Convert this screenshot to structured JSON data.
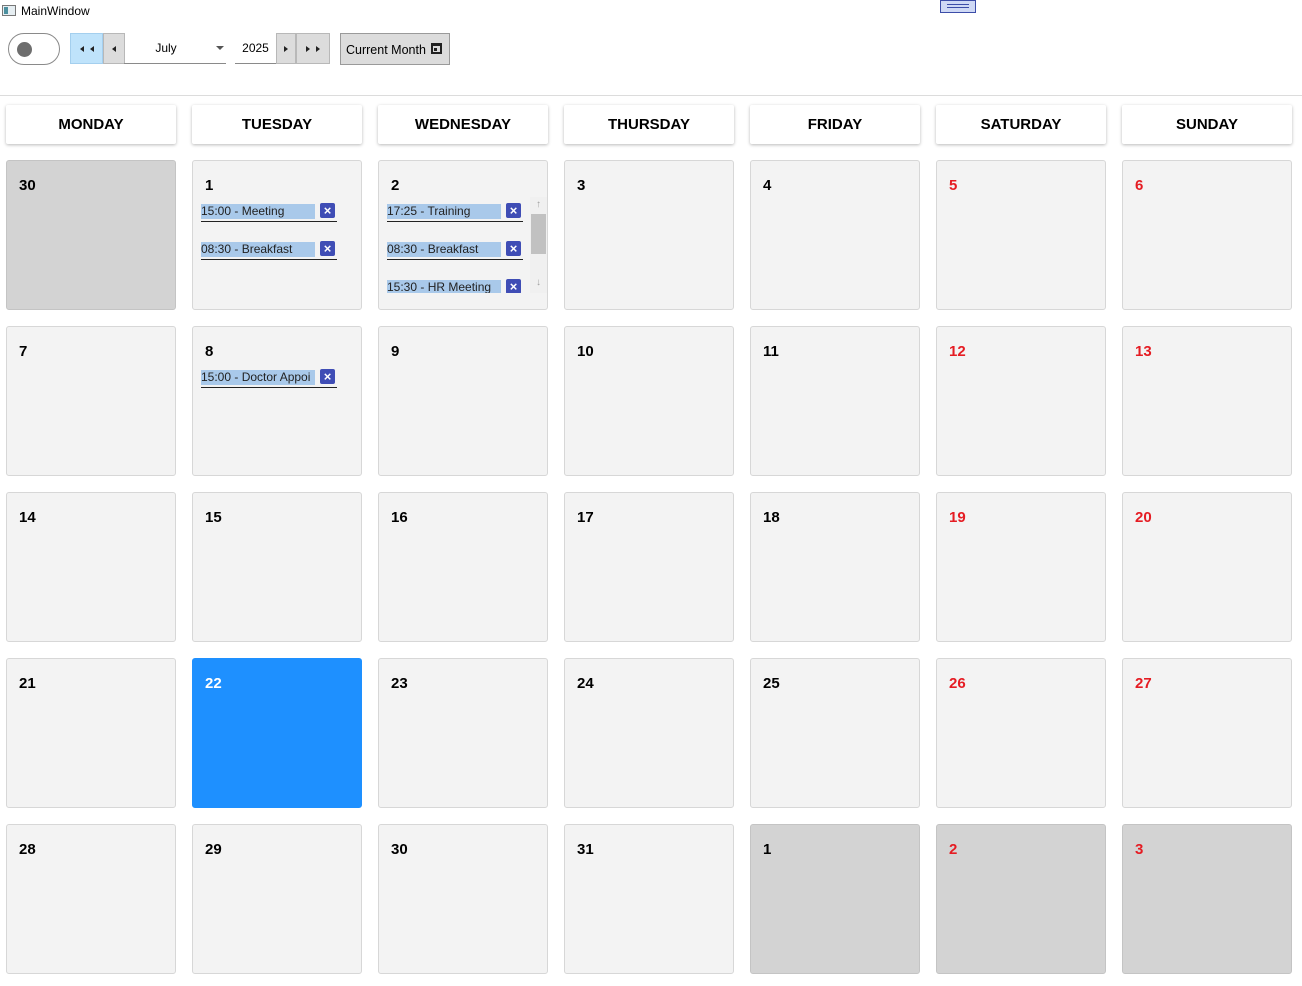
{
  "window": {
    "title": "MainWindow"
  },
  "toolbar": {
    "month": "July",
    "year": "2025",
    "current_month_label": "Current Month"
  },
  "weekdays": [
    "MONDAY",
    "TUESDAY",
    "WEDNESDAY",
    "THURSDAY",
    "FRIDAY",
    "SATURDAY",
    "SUNDAY"
  ],
  "colors": {
    "today": "#1e90ff",
    "weekend_day": "#e51c23",
    "event_bg": "#a9c9ea",
    "delete_button": "#3f4db5"
  },
  "days": [
    {
      "day": "30",
      "other_month": true,
      "weekend": false,
      "today": false,
      "events": []
    },
    {
      "day": "1",
      "other_month": false,
      "weekend": false,
      "today": false,
      "events": [
        "15:00 - Meeting",
        "08:30 - Breakfast"
      ]
    },
    {
      "day": "2",
      "other_month": false,
      "weekend": false,
      "today": false,
      "events": [
        "17:25 - Training",
        "08:30 - Breakfast",
        "15:30 - HR Meeting"
      ],
      "scrollbar": true
    },
    {
      "day": "3",
      "other_month": false,
      "weekend": false,
      "today": false,
      "events": []
    },
    {
      "day": "4",
      "other_month": false,
      "weekend": false,
      "today": false,
      "events": []
    },
    {
      "day": "5",
      "other_month": false,
      "weekend": true,
      "today": false,
      "events": []
    },
    {
      "day": "6",
      "other_month": false,
      "weekend": true,
      "today": false,
      "events": []
    },
    {
      "day": "7",
      "other_month": false,
      "weekend": false,
      "today": false,
      "events": []
    },
    {
      "day": "8",
      "other_month": false,
      "weekend": false,
      "today": false,
      "events": [
        "15:00 - Doctor Appoi"
      ]
    },
    {
      "day": "9",
      "other_month": false,
      "weekend": false,
      "today": false,
      "events": []
    },
    {
      "day": "10",
      "other_month": false,
      "weekend": false,
      "today": false,
      "events": []
    },
    {
      "day": "11",
      "other_month": false,
      "weekend": false,
      "today": false,
      "events": []
    },
    {
      "day": "12",
      "other_month": false,
      "weekend": true,
      "today": false,
      "events": []
    },
    {
      "day": "13",
      "other_month": false,
      "weekend": true,
      "today": false,
      "events": []
    },
    {
      "day": "14",
      "other_month": false,
      "weekend": false,
      "today": false,
      "events": []
    },
    {
      "day": "15",
      "other_month": false,
      "weekend": false,
      "today": false,
      "events": []
    },
    {
      "day": "16",
      "other_month": false,
      "weekend": false,
      "today": false,
      "events": []
    },
    {
      "day": "17",
      "other_month": false,
      "weekend": false,
      "today": false,
      "events": []
    },
    {
      "day": "18",
      "other_month": false,
      "weekend": false,
      "today": false,
      "events": []
    },
    {
      "day": "19",
      "other_month": false,
      "weekend": true,
      "today": false,
      "events": []
    },
    {
      "day": "20",
      "other_month": false,
      "weekend": true,
      "today": false,
      "events": []
    },
    {
      "day": "21",
      "other_month": false,
      "weekend": false,
      "today": false,
      "events": []
    },
    {
      "day": "22",
      "other_month": false,
      "weekend": false,
      "today": true,
      "events": []
    },
    {
      "day": "23",
      "other_month": false,
      "weekend": false,
      "today": false,
      "events": []
    },
    {
      "day": "24",
      "other_month": false,
      "weekend": false,
      "today": false,
      "events": []
    },
    {
      "day": "25",
      "other_month": false,
      "weekend": false,
      "today": false,
      "events": []
    },
    {
      "day": "26",
      "other_month": false,
      "weekend": true,
      "today": false,
      "events": []
    },
    {
      "day": "27",
      "other_month": false,
      "weekend": true,
      "today": false,
      "events": []
    },
    {
      "day": "28",
      "other_month": false,
      "weekend": false,
      "today": false,
      "events": []
    },
    {
      "day": "29",
      "other_month": false,
      "weekend": false,
      "today": false,
      "events": []
    },
    {
      "day": "30",
      "other_month": false,
      "weekend": false,
      "today": false,
      "events": []
    },
    {
      "day": "31",
      "other_month": false,
      "weekend": false,
      "today": false,
      "events": []
    },
    {
      "day": "1",
      "other_month": true,
      "weekend": false,
      "today": false,
      "events": []
    },
    {
      "day": "2",
      "other_month": true,
      "weekend": true,
      "today": false,
      "events": []
    },
    {
      "day": "3",
      "other_month": true,
      "weekend": true,
      "today": false,
      "events": []
    }
  ]
}
